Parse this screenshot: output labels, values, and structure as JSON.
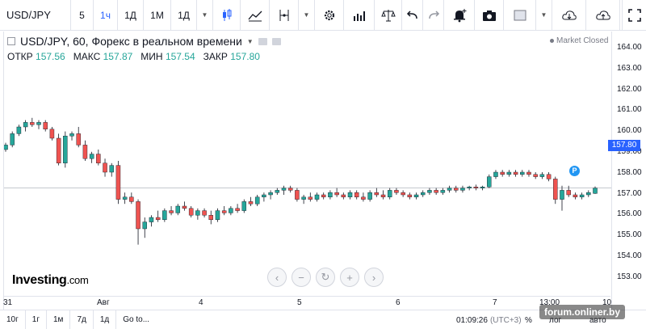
{
  "toolbar": {
    "symbol": "USD/JPY",
    "intervals": [
      "5",
      "1ч",
      "1Д",
      "1М",
      "1Д"
    ],
    "active_interval": "1ч"
  },
  "legend": {
    "title": "USD/JPY, 60, Форекс в реальном времени",
    "open_label": "ОТКР",
    "open": "157.56",
    "high_label": "МАКС",
    "high": "157.87",
    "low_label": "МИН",
    "low": "157.54",
    "close_label": "ЗАКР",
    "close": "157.80",
    "market_status": "Market Closed"
  },
  "price_axis": {
    "labels": [
      "164.00",
      "163.00",
      "162.00",
      "161.00",
      "160.00",
      "159.00",
      "158.00",
      "157.00",
      "156.00",
      "155.00",
      "154.00",
      "153.00"
    ],
    "current": "157.80"
  },
  "time_axis": {
    "labels": [
      "31",
      "Авг",
      "4",
      "5",
      "6",
      "7",
      "13:00",
      "10"
    ]
  },
  "badge": "P",
  "logo": {
    "main": "Investing",
    "suffix": ".com"
  },
  "bottom_bar": {
    "ranges": [
      "10г",
      "1г",
      "1м",
      "7д",
      "1д"
    ],
    "goto": "Go to...",
    "time": "01:09:26",
    "tz": "(UTC+3)",
    "pct": "%",
    "log": "лог",
    "auto": "авто"
  },
  "watermark": "forum.onliner.by",
  "colors": {
    "up": "#26a69a",
    "down": "#ef5350",
    "accent": "#2962ff"
  },
  "chart_data": {
    "type": "candlestick",
    "series": [
      {
        "name": "USD/JPY",
        "ohlc": [
          [
            159.5,
            159.8,
            159.4,
            159.7
          ],
          [
            159.7,
            160.3,
            159.6,
            160.2
          ],
          [
            160.2,
            160.6,
            160.1,
            160.5
          ],
          [
            160.5,
            160.8,
            160.3,
            160.7
          ],
          [
            160.7,
            160.9,
            160.5,
            160.6
          ],
          [
            160.6,
            160.8,
            160.4,
            160.7
          ],
          [
            160.7,
            160.8,
            160.3,
            160.4
          ],
          [
            160.4,
            160.5,
            159.9,
            160.0
          ],
          [
            160.0,
            160.2,
            158.8,
            158.9
          ],
          [
            158.9,
            160.3,
            158.7,
            160.1
          ],
          [
            160.1,
            160.3,
            159.9,
            160.2
          ],
          [
            160.2,
            160.5,
            159.6,
            159.7
          ],
          [
            159.7,
            159.9,
            159.0,
            159.1
          ],
          [
            159.1,
            159.4,
            158.9,
            159.3
          ],
          [
            159.3,
            159.5,
            158.8,
            158.9
          ],
          [
            158.9,
            159.1,
            158.3,
            158.5
          ],
          [
            158.5,
            158.9,
            158.3,
            158.8
          ],
          [
            158.8,
            159.0,
            157.1,
            157.3
          ],
          [
            157.3,
            157.6,
            157.1,
            157.4
          ],
          [
            157.4,
            157.6,
            157.1,
            157.2
          ],
          [
            157.2,
            157.3,
            155.3,
            156.0
          ],
          [
            156.0,
            156.5,
            155.6,
            156.3
          ],
          [
            156.3,
            156.6,
            156.1,
            156.5
          ],
          [
            156.5,
            156.8,
            156.3,
            156.4
          ],
          [
            156.4,
            156.9,
            156.3,
            156.8
          ],
          [
            156.8,
            157.0,
            156.6,
            156.7
          ],
          [
            156.7,
            157.1,
            156.6,
            157.0
          ],
          [
            157.0,
            157.2,
            156.8,
            156.9
          ],
          [
            156.9,
            157.0,
            156.5,
            156.6
          ],
          [
            156.6,
            156.9,
            156.4,
            156.8
          ],
          [
            156.8,
            156.9,
            156.5,
            156.6
          ],
          [
            156.6,
            156.8,
            156.2,
            156.4
          ],
          [
            156.4,
            156.9,
            156.3,
            156.8
          ],
          [
            156.8,
            157.0,
            156.6,
            156.7
          ],
          [
            156.7,
            157.0,
            156.6,
            156.9
          ],
          [
            156.9,
            157.1,
            156.7,
            156.8
          ],
          [
            156.8,
            157.3,
            156.7,
            157.2
          ],
          [
            157.2,
            157.4,
            157.0,
            157.1
          ],
          [
            157.1,
            157.5,
            157.0,
            157.4
          ],
          [
            157.4,
            157.6,
            157.2,
            157.5
          ],
          [
            157.5,
            157.7,
            157.3,
            157.6
          ],
          [
            157.6,
            157.8,
            157.5,
            157.7
          ],
          [
            157.7,
            157.9,
            157.5,
            157.8
          ],
          [
            157.8,
            157.9,
            157.6,
            157.7
          ],
          [
            157.7,
            157.8,
            157.2,
            157.3
          ],
          [
            157.3,
            157.5,
            157.1,
            157.4
          ],
          [
            157.4,
            157.6,
            157.2,
            157.3
          ],
          [
            157.3,
            157.6,
            157.2,
            157.5
          ],
          [
            157.5,
            157.6,
            157.3,
            157.4
          ],
          [
            157.4,
            157.7,
            157.3,
            157.6
          ],
          [
            157.6,
            157.8,
            157.4,
            157.5
          ],
          [
            157.5,
            157.6,
            157.3,
            157.4
          ],
          [
            157.4,
            157.7,
            157.3,
            157.6
          ],
          [
            157.6,
            157.7,
            157.3,
            157.4
          ],
          [
            157.4,
            157.6,
            157.2,
            157.3
          ],
          [
            157.3,
            157.7,
            157.2,
            157.6
          ],
          [
            157.6,
            157.8,
            157.4,
            157.5
          ],
          [
            157.5,
            157.7,
            157.3,
            157.4
          ],
          [
            157.4,
            157.8,
            157.3,
            157.7
          ],
          [
            157.7,
            157.8,
            157.5,
            157.6
          ],
          [
            157.6,
            157.7,
            157.4,
            157.5
          ],
          [
            157.5,
            157.6,
            157.3,
            157.4
          ],
          [
            157.4,
            157.6,
            157.3,
            157.5
          ],
          [
            157.5,
            157.7,
            157.4,
            157.6
          ],
          [
            157.6,
            157.8,
            157.5,
            157.7
          ],
          [
            157.7,
            157.8,
            157.5,
            157.6
          ],
          [
            157.6,
            157.8,
            157.5,
            157.7
          ],
          [
            157.7,
            157.9,
            157.6,
            157.8
          ],
          [
            157.8,
            157.9,
            157.6,
            157.7
          ],
          [
            157.7,
            157.9,
            157.6,
            157.8
          ],
          [
            157.8,
            157.9,
            157.7,
            157.85
          ],
          [
            157.85,
            157.95,
            157.7,
            157.8
          ],
          [
            157.8,
            157.9,
            157.7,
            157.85
          ],
          [
            157.85,
            158.4,
            157.8,
            158.3
          ],
          [
            158.3,
            158.6,
            158.2,
            158.5
          ],
          [
            158.5,
            158.6,
            158.3,
            158.4
          ],
          [
            158.4,
            158.6,
            158.3,
            158.5
          ],
          [
            158.5,
            158.6,
            158.3,
            158.4
          ],
          [
            158.4,
            158.6,
            158.3,
            158.5
          ],
          [
            158.5,
            158.6,
            158.3,
            158.4
          ],
          [
            158.4,
            158.5,
            158.2,
            158.3
          ],
          [
            158.3,
            158.5,
            158.2,
            158.4
          ],
          [
            158.4,
            158.5,
            158.1,
            158.2
          ],
          [
            158.2,
            158.3,
            157.1,
            157.3
          ],
          [
            157.3,
            157.9,
            156.8,
            157.7
          ],
          [
            157.7,
            157.9,
            157.4,
            157.5
          ],
          [
            157.5,
            157.6,
            157.3,
            157.4
          ],
          [
            157.4,
            157.6,
            157.3,
            157.5
          ],
          [
            157.5,
            157.7,
            157.4,
            157.6
          ],
          [
            157.56,
            157.87,
            157.54,
            157.8
          ]
        ]
      }
    ],
    "ylim": [
      152.5,
      164.5
    ],
    "grid": false
  }
}
